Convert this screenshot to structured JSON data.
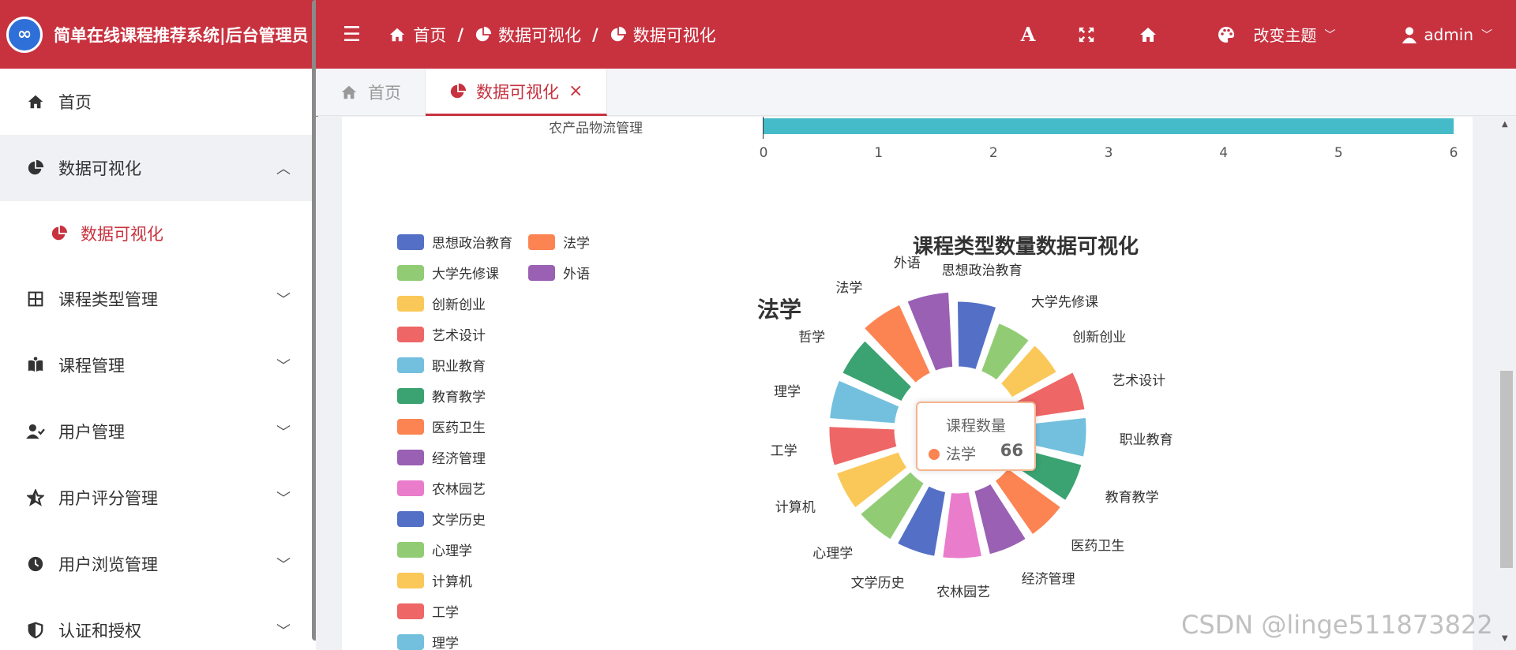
{
  "app": {
    "title": "简单在线课程推荐系统|后台管理员",
    "logo_text": "∞"
  },
  "sidebar": {
    "items": [
      {
        "label": "首页",
        "icon": "home-icon"
      },
      {
        "label": "数据可视化",
        "icon": "pie-chart-icon",
        "open": true
      },
      {
        "label": "数据可视化",
        "icon": "pie-chart-icon",
        "sub": true
      },
      {
        "label": "课程类型管理",
        "icon": "grid-icon"
      },
      {
        "label": "课程管理",
        "icon": "book-icon"
      },
      {
        "label": "用户管理",
        "icon": "user-check-icon"
      },
      {
        "label": "用户评分管理",
        "icon": "star-icon"
      },
      {
        "label": "用户浏览管理",
        "icon": "clock-icon"
      },
      {
        "label": "认证和授权",
        "icon": "shield-icon"
      }
    ]
  },
  "header": {
    "breadcrumbs": [
      {
        "label": "首页",
        "icon": "home-icon"
      },
      {
        "label": "数据可视化",
        "icon": "pie-chart-icon"
      },
      {
        "label": "数据可视化",
        "icon": "pie-chart-icon"
      }
    ],
    "separator": "/",
    "font_button": "A",
    "theme_label": "改变主题",
    "user_label": "admin"
  },
  "tabs": [
    {
      "label": "首页",
      "icon": "home-icon",
      "active": false
    },
    {
      "label": "数据可视化",
      "icon": "pie-chart-icon",
      "active": true,
      "close": "×"
    }
  ],
  "bar_remnant": {
    "category": "农产品物流管理",
    "value": 6,
    "ticks": [
      "0",
      "1",
      "2",
      "3",
      "4",
      "5",
      "6"
    ]
  },
  "chart_data": {
    "type": "pie",
    "variant": "rose-donut",
    "title": "课程类型数量数据可视化",
    "emphasis_label": "法学",
    "legend_position": "top-left",
    "categories": [
      "思想政治教育",
      "法学",
      "大学先修课",
      "外语",
      "创新创业",
      "艺术设计",
      "职业教育",
      "教育教学",
      "医药卫生",
      "经济管理",
      "农林园艺",
      "文学历史",
      "心理学",
      "计算机",
      "工学",
      "理学",
      "哲学"
    ],
    "colors": [
      "#5470c6",
      "#fc8452",
      "#91cc75",
      "#9a60b4",
      "#fac858",
      "#ee6666",
      "#73c0de",
      "#3ba272",
      "#fc8452",
      "#9a60b4",
      "#ea7ccc",
      "#5470c6",
      "#91cc75",
      "#fac858",
      "#ee6666",
      "#73c0de",
      "#3ba272"
    ]
  },
  "tooltip": {
    "title": "课程数量",
    "name": "法学",
    "value": "66"
  },
  "watermark": "CSDN @linge511873822"
}
